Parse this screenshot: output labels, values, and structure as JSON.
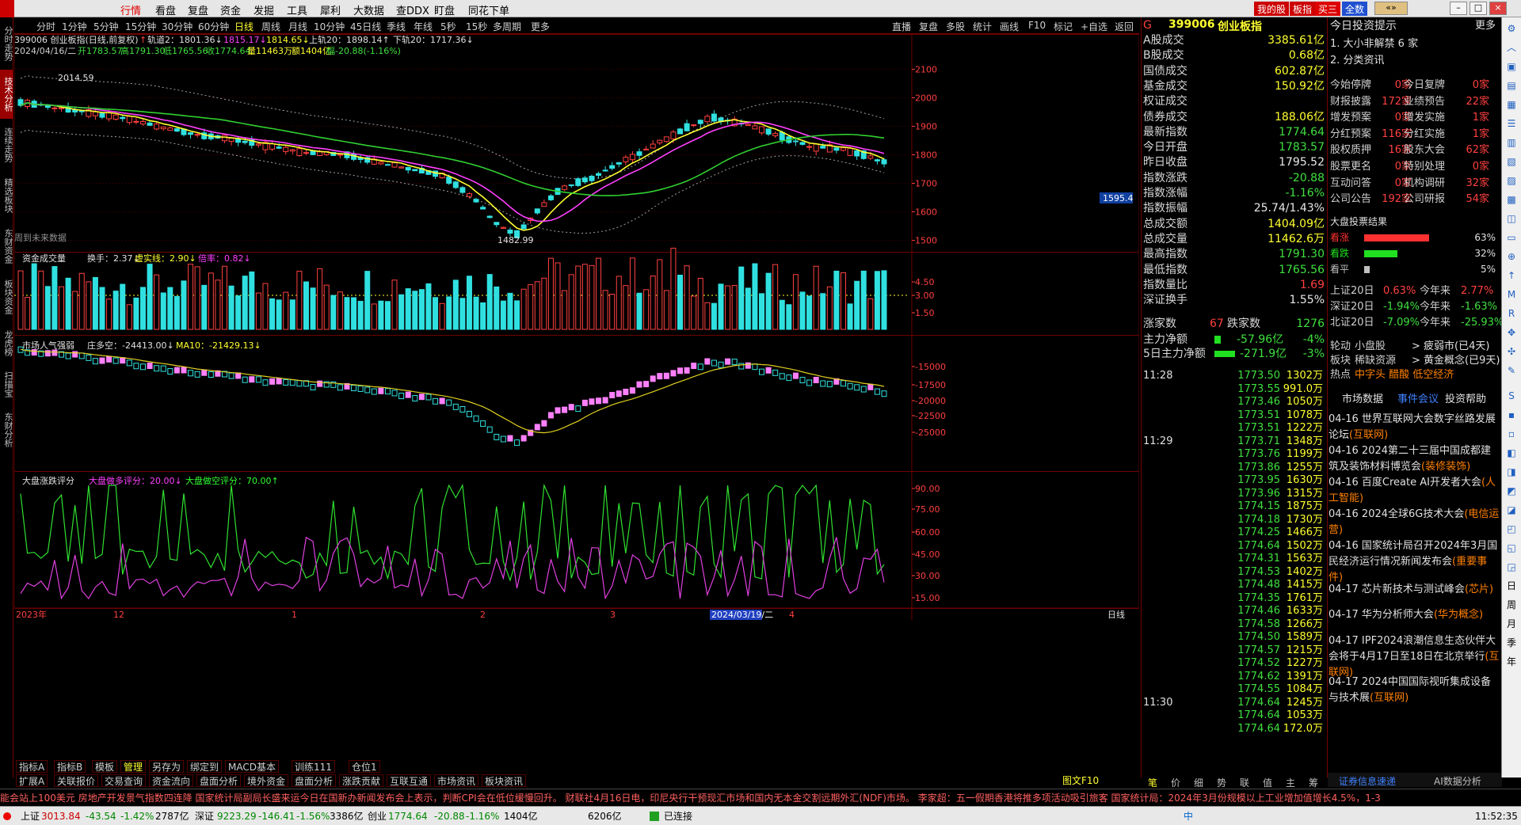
{
  "colors": {
    "up": "#ff4040",
    "down": "#3fe0e0",
    "ma_yellow": "#ffff30",
    "ma_mag": "#ff40ff",
    "ma_green": "#30d030",
    "grid": "#700000",
    "bg": "#000000"
  },
  "menubar": {
    "items": [
      "行情",
      "看盘",
      "复盘",
      "资金",
      "发掘",
      "工具",
      "犀利",
      "大数据",
      "查DDX",
      "盯盘",
      "同花下单"
    ],
    "active": "行情",
    "right": [
      "我的股",
      "板指",
      "买三",
      "全数"
    ]
  },
  "left_tabs": [
    "分时走势",
    "技术分析",
    "连续走势",
    "精选板块",
    "东财资金",
    "板块资金",
    "龙虎榜",
    "扫描宝",
    "东财分析"
  ],
  "toolbar": {
    "periods": [
      "分时",
      "1分钟",
      "5分钟",
      "15分钟",
      "30分钟",
      "60分钟",
      "日线",
      "周线",
      "月线",
      "10分钟",
      "45日线",
      "季线",
      "年线",
      "5秒",
      "15秒",
      "多周期",
      "更多"
    ],
    "active": "日线",
    "right": [
      "直播",
      "复盘",
      "多股",
      "统计",
      "画线",
      "F10",
      "标记",
      "+自选",
      "返回"
    ]
  },
  "main_chart": {
    "title": "399006 创业板指(日线,前复权)",
    "ma_bands": "轨道2：1801.36↓",
    "b2": "1815.17↓",
    "b3": "1814.65↓",
    "up20": "上轨20：1898.14↑",
    "down20": "下轨20：1717.36↓",
    "ohlc_date": "2024/04/16/二",
    "open": "开1783.57",
    "high": "高1791.30",
    "low": "低1765.56",
    "close": "收1774.64",
    "vol": "量11463万",
    "amt": "额1404亿",
    "chg": "幅-20.88(-1.16%)",
    "max_label": "2014.59",
    "min_label": "1482.99",
    "future_label": "周到未来数据",
    "cur_price": "1595.4",
    "y_ticks": [
      "2100",
      "2000",
      "1900",
      "1800",
      "1700",
      "1600",
      "1500"
    ],
    "chart_data": {
      "type": "candlestick",
      "ylim": [
        1460,
        2140
      ],
      "max": 2014.59,
      "min": 1482.99
    }
  },
  "vol_panel": {
    "title": "资金成交量",
    "turn": "换手：2.37↓",
    "real": "虚实线：2.90↓",
    "ratio": "倍率：0.82↓",
    "y_ticks": [
      "4.50",
      "3.00",
      "1.50"
    ]
  },
  "sent_panel": {
    "title": "市场人气强弱",
    "val": "庄多空：-24413.00↓",
    "ma": "MA10：-21429.13↓",
    "y_ticks": [
      "-15000",
      "-17500",
      "-20000",
      "-22500",
      "-25000"
    ]
  },
  "score_panel": {
    "title": "大盘涨跌评分",
    "a": "大盘做多评分：20.00↓",
    "b": "大盘做空评分：70.00↑",
    "y_ticks": [
      "90.00",
      "75.00",
      "60.00",
      "45.00",
      "30.00",
      "15.00"
    ]
  },
  "x_axis": {
    "labels": [
      "2023年",
      "12",
      "1",
      "2",
      "3",
      "2024/03/19/二",
      "4"
    ],
    "period": "日线"
  },
  "bottom_tabs_1": [
    "指标A",
    "指标B",
    "模板",
    "管理",
    "另存为",
    "绑定到",
    "MACD基本",
    "训练111",
    "仓位1"
  ],
  "bottom_tabs_2": [
    "扩展A",
    "关联报价",
    "交易查询",
    "资金流向",
    "盘面分析",
    "境外资金",
    "盘面分析",
    "涨跌贡献",
    "互联互通",
    "市场资讯",
    "板块资讯"
  ],
  "bottom_right": "图文F10",
  "right_panel": {
    "code": "399006",
    "name": "创业板指",
    "rows": [
      {
        "l": "A股成交",
        "v": "3385.61亿",
        "c": "yellow"
      },
      {
        "l": "B股成交",
        "v": "0.68亿",
        "c": "yellow"
      },
      {
        "l": "国债成交",
        "v": "602.87亿",
        "c": "yellow"
      },
      {
        "l": "基金成交",
        "v": "150.92亿",
        "c": "yellow"
      },
      {
        "l": "权证成交",
        "v": "",
        "c": "yellow"
      },
      {
        "l": "债券成交",
        "v": "188.06亿",
        "c": "yellow"
      },
      {
        "l": "最新指数",
        "v": "1774.64",
        "c": "green"
      },
      {
        "l": "今日开盘",
        "v": "1783.57",
        "c": "green"
      },
      {
        "l": "昨日收盘",
        "v": "1795.52",
        "c": "white"
      },
      {
        "l": "指数涨跌",
        "v": "-20.88",
        "c": "green"
      },
      {
        "l": "指数涨幅",
        "v": "-1.16%",
        "c": "green"
      },
      {
        "l": "指数振幅",
        "v": "25.74/1.43%",
        "c": "white"
      },
      {
        "l": "总成交额",
        "v": "1404.09亿",
        "c": "yellow"
      },
      {
        "l": "总成交量",
        "v": "11462.6万",
        "c": "yellow"
      },
      {
        "l": "最高指数",
        "v": "1791.30",
        "c": "green"
      },
      {
        "l": "最低指数",
        "v": "1765.56",
        "c": "green"
      },
      {
        "l": "指数量比",
        "v": "1.69",
        "c": "red"
      },
      {
        "l": "深证换手",
        "v": "1.55%",
        "c": "white"
      }
    ],
    "updown": {
      "up_label": "涨家数",
      "up": "67",
      "down_label": "跌家数",
      "down": "1276"
    },
    "flow1": {
      "l": "主力净额",
      "v": "-57.96亿",
      "p": "-4%"
    },
    "flow2": {
      "l": "5日主力净额",
      "v": "-271.9亿",
      "p": "-3%"
    },
    "ticks": [
      {
        "t": "11:28",
        "p": "1773.50",
        "q": "1302万"
      },
      {
        "t": "",
        "p": "1773.55",
        "q": "991.0万"
      },
      {
        "t": "",
        "p": "1773.46",
        "q": "1050万"
      },
      {
        "t": "",
        "p": "1773.51",
        "q": "1078万"
      },
      {
        "t": "",
        "p": "1773.51",
        "q": "1222万"
      },
      {
        "t": "11:29",
        "p": "1773.71",
        "q": "1348万"
      },
      {
        "t": "",
        "p": "1773.76",
        "q": "1199万"
      },
      {
        "t": "",
        "p": "1773.86",
        "q": "1255万"
      },
      {
        "t": "",
        "p": "1773.95",
        "q": "1630万"
      },
      {
        "t": "",
        "p": "1773.96",
        "q": "1315万"
      },
      {
        "t": "",
        "p": "1774.15",
        "q": "1875万"
      },
      {
        "t": "",
        "p": "1774.18",
        "q": "1730万"
      },
      {
        "t": "",
        "p": "1774.25",
        "q": "1466万"
      },
      {
        "t": "",
        "p": "1774.64",
        "q": "1502万"
      },
      {
        "t": "",
        "p": "1774.31",
        "q": "1563万"
      },
      {
        "t": "",
        "p": "1774.53",
        "q": "1402万"
      },
      {
        "t": "",
        "p": "1774.48",
        "q": "1415万"
      },
      {
        "t": "",
        "p": "1774.35",
        "q": "1761万"
      },
      {
        "t": "",
        "p": "1774.46",
        "q": "1633万"
      },
      {
        "t": "",
        "p": "1774.58",
        "q": "1266万"
      },
      {
        "t": "",
        "p": "1774.50",
        "q": "1589万"
      },
      {
        "t": "",
        "p": "1774.57",
        "q": "1215万"
      },
      {
        "t": "",
        "p": "1774.52",
        "q": "1227万"
      },
      {
        "t": "",
        "p": "1774.62",
        "q": "1391万"
      },
      {
        "t": "",
        "p": "1774.55",
        "q": "1084万"
      },
      {
        "t": "11:30",
        "p": "1774.64",
        "q": "1245万"
      },
      {
        "t": "",
        "p": "1774.64",
        "q": "1053万"
      },
      {
        "t": "",
        "p": "1774.64",
        "q": "172.0万"
      }
    ],
    "bottom_tabs": [
      "笔",
      "价",
      "细",
      "势",
      "联",
      "值",
      "主",
      "筹"
    ]
  },
  "info_panel": {
    "title": "今日投资提示",
    "more": "更多",
    "items": [
      "1. 大小非解禁 6 家",
      "2. 分类资讯"
    ],
    "stats": [
      [
        "今始停牌",
        "0家",
        "今日复牌",
        "0家"
      ],
      [
        "财报披露",
        "172家",
        "业绩预告",
        "22家"
      ],
      [
        "增发预案",
        "0家",
        "增发实施",
        "1家"
      ],
      [
        "分红预案",
        "116家",
        "分红实施",
        "1家"
      ],
      [
        "股权质押",
        "16家",
        "股东大会",
        "62家"
      ],
      [
        "股票更名",
        "0家",
        "特别处理",
        "0家"
      ],
      [
        "互动问答",
        "0家",
        "机构调研",
        "32家"
      ],
      [
        "公司公告",
        "192家",
        "公司研报",
        "54家"
      ]
    ],
    "vote_title": "大盘投票结果",
    "votes": [
      {
        "l": "看涨",
        "p": "63%",
        "c": "#ff3030",
        "w": 63
      },
      {
        "l": "看跌",
        "p": "32%",
        "c": "#20e020",
        "w": 32
      },
      {
        "l": "看平",
        "p": "5%",
        "c": "#c0c0c0",
        "w": 5
      }
    ],
    "north": [
      {
        "l": "上证20日",
        "a": "0.63%",
        "b": "今年来",
        "c": "2.77%"
      },
      {
        "l": "深证20日",
        "a": "-1.94%",
        "b": "今年来",
        "c": "-1.63%"
      },
      {
        "l": "北证20日",
        "a": "-7.09%",
        "b": "今年来",
        "c": "-25.93%"
      }
    ],
    "hot": [
      {
        "a": "轮动",
        "b": "小盘股",
        "c": "疲弱市(已4天)"
      },
      {
        "a": "板块",
        "b": "稀缺资源",
        "c": "黄金概念(已9天)"
      },
      {
        "a": "热点",
        "b": "中字头 醋酸 低空经济",
        "c": ""
      }
    ],
    "tabs": [
      "市场数据",
      "事件会议",
      "投资帮助"
    ],
    "news": [
      {
        "d": "04-16",
        "t": "世界互联网大会数字丝路发展论坛",
        "tag": "(互联网)"
      },
      {
        "d": "04-16",
        "t": "2024第二十三届中国成都建筑及装饰材料博览会",
        "tag": "(装修装饰)"
      },
      {
        "d": "04-16",
        "t": "百度Create AI开发者大会",
        "tag": "(人工智能)"
      },
      {
        "d": "04-16",
        "t": "2024全球6G技术大会",
        "tag": "(电信运营)"
      },
      {
        "d": "04-16",
        "t": "国家统计局召开2024年3月国民经济运行情况新闻发布会",
        "tag": "(重要事件)"
      },
      {
        "d": "04-17",
        "t": "芯片新技术与测试峰会",
        "tag": "(芯片)"
      },
      {
        "d": "04-17",
        "t": "华为分析师大会",
        "tag": "(华为概念)"
      },
      {
        "d": "04-17",
        "t": "IPF2024浪潮信息生态伙伴大会将于4月17日至18日在北京举行",
        "tag": "(互联网)"
      },
      {
        "d": "04-17",
        "t": "2024中国国际视听集成设备与技术展",
        "tag": "(互联网)"
      }
    ],
    "bottom": [
      "证券信息速递",
      "AI数据分析"
    ]
  },
  "ticker": "能会站上100美元   房地产开发景气指数四连降   国家统计局副局长盛来运今日在国新办新闻发布会上表示，判断CPI会在低位缓慢回升。   财联社4月16日电，印尼央行干预现汇市场和国内无本金交割远期外汇(NDF)市场。   李家超：五一假期香港将推多项活动吸引旅客   国家统计局：2024年3月份规模以上工业增加值增长4.5%，1-3",
  "status": {
    "sh": "上证",
    "sh_v": "3013.84",
    "sh_c": "-43.54",
    "sh_p": "-1.42%",
    "sh_a": "2787亿",
    "sz": "深证",
    "sz_v": "9223.29",
    "sz_c": "-146.41",
    "sz_p": "-1.56%",
    "sz_a": "3386亿",
    "cy": "创业",
    "cy_v": "1774.64",
    "cy_c": "-20.88",
    "cy_p": "-1.16%",
    "cy_a": "1404亿",
    "x": "6206亿",
    "conn": "已连接",
    "time": "11:52:35",
    "input": "中"
  }
}
